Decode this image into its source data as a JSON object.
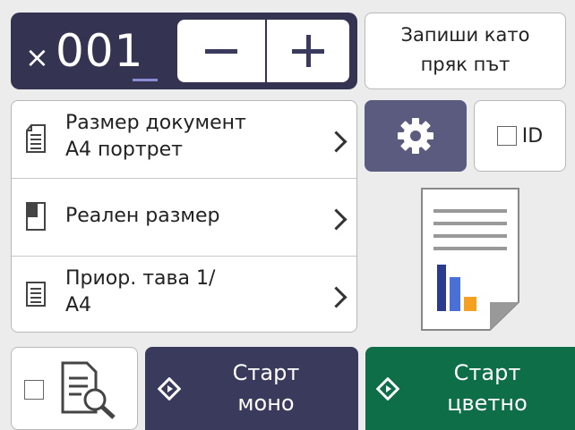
{
  "copies": {
    "prefix": "×",
    "value": "001"
  },
  "shortcut": {
    "label": "Запиши като\nпряк път"
  },
  "settings": [
    {
      "label": "Размер документ\nA4 портрет",
      "icon": "document-size-icon"
    },
    {
      "label": "Реален размер",
      "icon": "page-enlarge-icon"
    },
    {
      "label": "Приор. тава 1/\nA4",
      "icon": "tray-icon"
    }
  ],
  "id_copy": {
    "label": "ID"
  },
  "start_mono": {
    "label": "Старт\nмоно"
  },
  "start_color": {
    "label": "Старт\nцветно"
  },
  "colors": {
    "dark": "#343452",
    "mono": "#3a3a5c",
    "color": "#0e6e48",
    "gear": "#5b5b80"
  }
}
